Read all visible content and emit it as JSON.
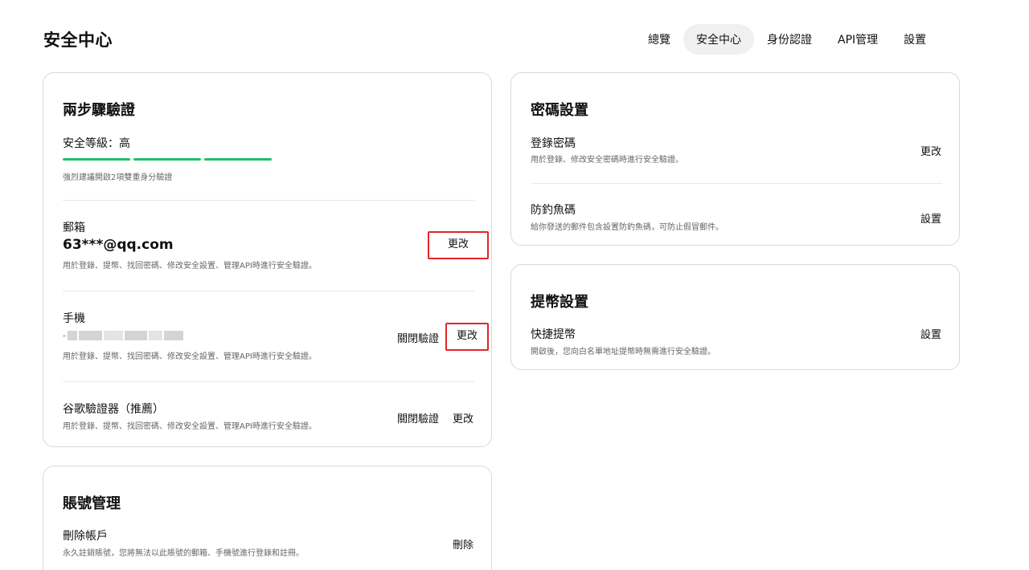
{
  "page": {
    "title": "安全中心"
  },
  "nav": {
    "tabs": [
      {
        "label": "總覽",
        "active": false
      },
      {
        "label": "安全中心",
        "active": true
      },
      {
        "label": "身份認證",
        "active": false
      },
      {
        "label": "API管理",
        "active": false
      },
      {
        "label": "設置",
        "active": false
      }
    ]
  },
  "two_step": {
    "title": "兩步驟驗證",
    "level_label": "安全等級：高",
    "level_filled": 3,
    "level_total": 3,
    "level_color": "#1fc06b",
    "hint": "強烈建議開啟2項雙重身分驗證",
    "email": {
      "title": "郵箱",
      "value": "63***@qq.com",
      "desc": "用於登錄、提幣、找回密碼、修改安全設置、管理API時進行安全驗證。",
      "change": "更改"
    },
    "phone": {
      "title": "手機",
      "desc": "用於登錄、提幣、找回密碼、修改安全設置、管理API時進行安全驗證。",
      "disable": "關閉驗證",
      "change": "更改"
    },
    "google": {
      "title": "谷歌驗證器（推薦）",
      "desc": "用於登錄、提幣、找回密碼、修改安全設置、管理API時進行安全驗證。",
      "disable": "關閉驗證",
      "change": "更改"
    }
  },
  "account": {
    "title": "賬號管理",
    "delete": {
      "title": "刪除帳戶",
      "desc": "永久註銷賬號，您將無法以此賬號的郵箱、手機號進行登錄和註冊。",
      "action": "刪除"
    }
  },
  "password": {
    "title": "密碼設置",
    "login": {
      "title": "登錄密碼",
      "desc": "用於登錄、修改安全密碼時進行安全驗證。",
      "action": "更改"
    },
    "antiphishing": {
      "title": "防釣魚碼",
      "desc": "給你發送的郵件包含設置防釣魚碼，可防止假冒郵件。",
      "action": "設置"
    }
  },
  "withdraw": {
    "title": "提幣設置",
    "quick": {
      "title": "快捷提幣",
      "desc": "開啟後，您向白名單地址提幣時無需進行安全驗證。",
      "action": "設置"
    }
  },
  "highlight_color": "#e0262b"
}
